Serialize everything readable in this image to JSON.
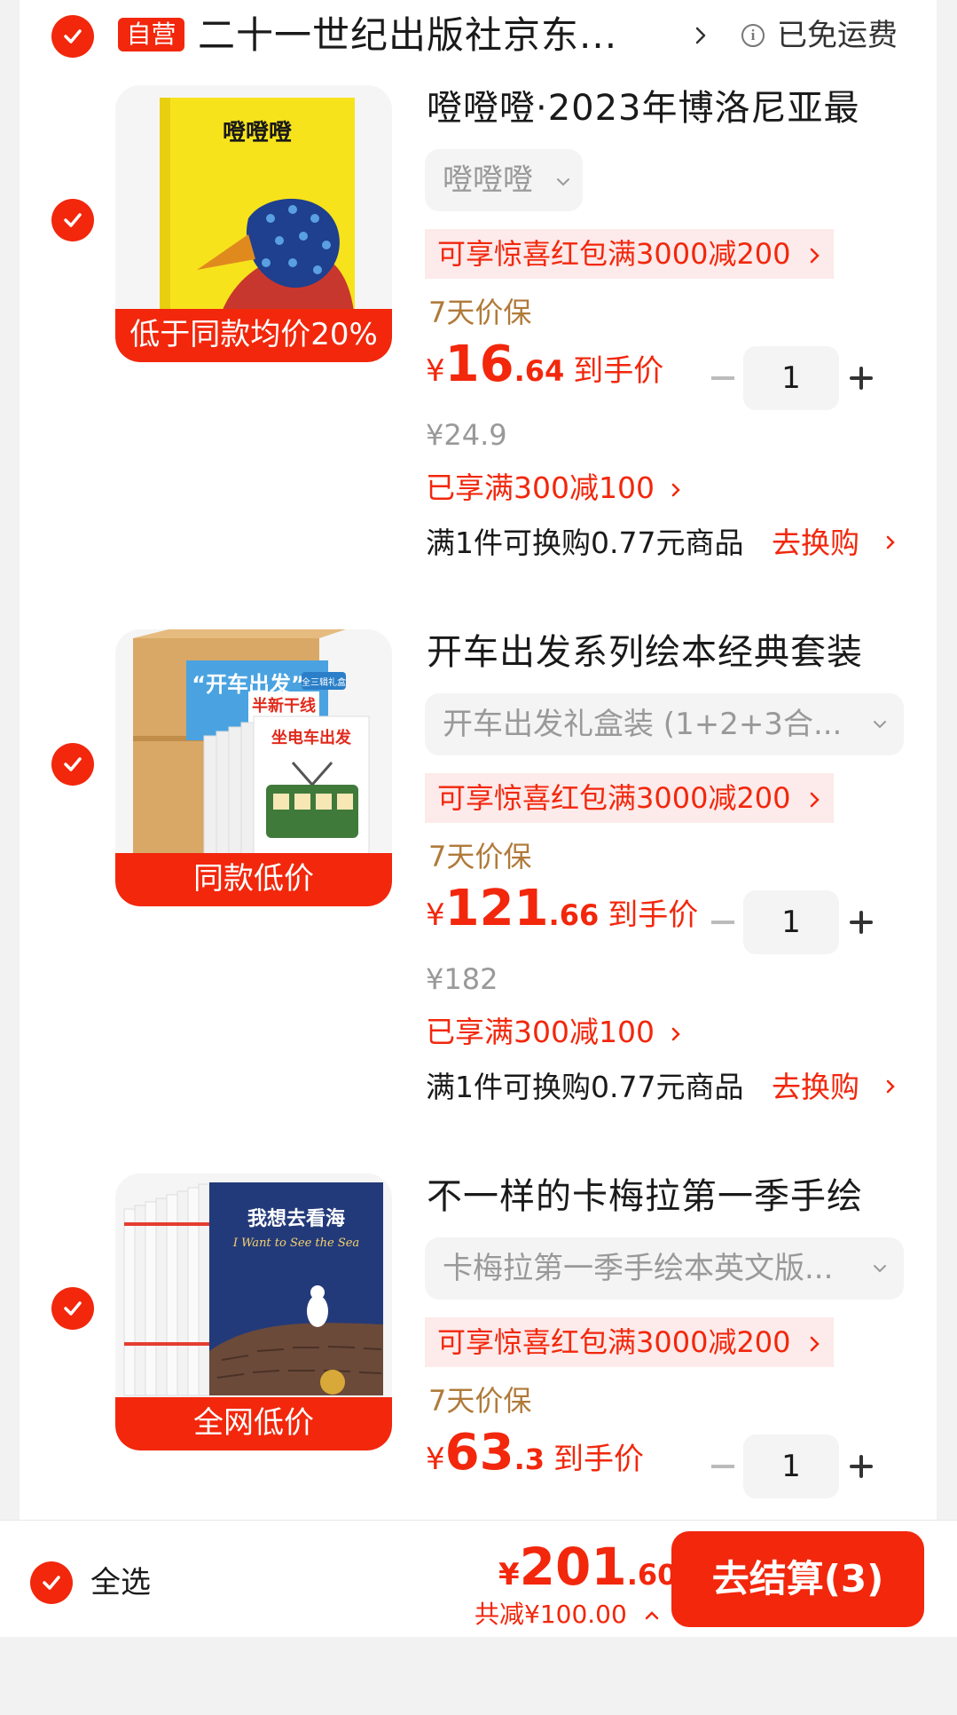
{
  "shop": {
    "self_badge": "自营",
    "name": "二十一世纪出版社京东...",
    "free_shipping": "已免运费"
  },
  "items": [
    {
      "title": "噔噔噔·2023年博洛尼亚最",
      "thumb_label": "低于同款均价20%",
      "spec": "噔噔噔",
      "redpack": "可享惊喜红包满3000减200",
      "guarantee": "7天价保",
      "price_currency": "¥",
      "price_int": "16",
      "price_dec": ".64",
      "price_tag": "到手价",
      "quantity": "1",
      "original_price": "¥24.9",
      "promo": "已享满300减100",
      "exchange": "满1件可换购0.77元商品",
      "exchange_link": "去换购"
    },
    {
      "title": "开车出发系列绘本经典套装",
      "thumb_label": "同款低价",
      "spec": "开车出发礼盒装 (1+2+3合...",
      "redpack": "可享惊喜红包满3000减200",
      "guarantee": "7天价保",
      "price_currency": "¥",
      "price_int": "121",
      "price_dec": ".66",
      "price_tag": "到手价",
      "quantity": "1",
      "original_price": "¥182",
      "promo": "已享满300减100",
      "exchange": "满1件可换购0.77元商品",
      "exchange_link": "去换购"
    },
    {
      "title": "不一样的卡梅拉第一季手绘",
      "thumb_label": "全网低价",
      "spec": "卡梅拉第一季手绘本英文版...",
      "redpack": "可享惊喜红包满3000减200",
      "guarantee": "7天价保",
      "price_currency": "¥",
      "price_int": "63",
      "price_dec": ".3",
      "price_tag": "到手价",
      "quantity": "1"
    }
  ],
  "book_covers": {
    "item0_title": "噔噔噔",
    "item1_box": "“开车出发”",
    "item1_badge": "全三辑礼盒",
    "item1_banner": "坐电车出发",
    "item1_sub": "半新干线",
    "item2_title": "我想去看海",
    "item2_en": "I Want to See the Sea"
  },
  "bottom": {
    "select_all": "全选",
    "total_currency": "¥",
    "total_int": "201",
    "total_dec": ".60",
    "saved": "共减¥100.00",
    "checkout": "去结算(3)"
  },
  "colors": {
    "accent": "#f2270c",
    "guarantee": "#b07a3a",
    "muted": "#999999"
  }
}
